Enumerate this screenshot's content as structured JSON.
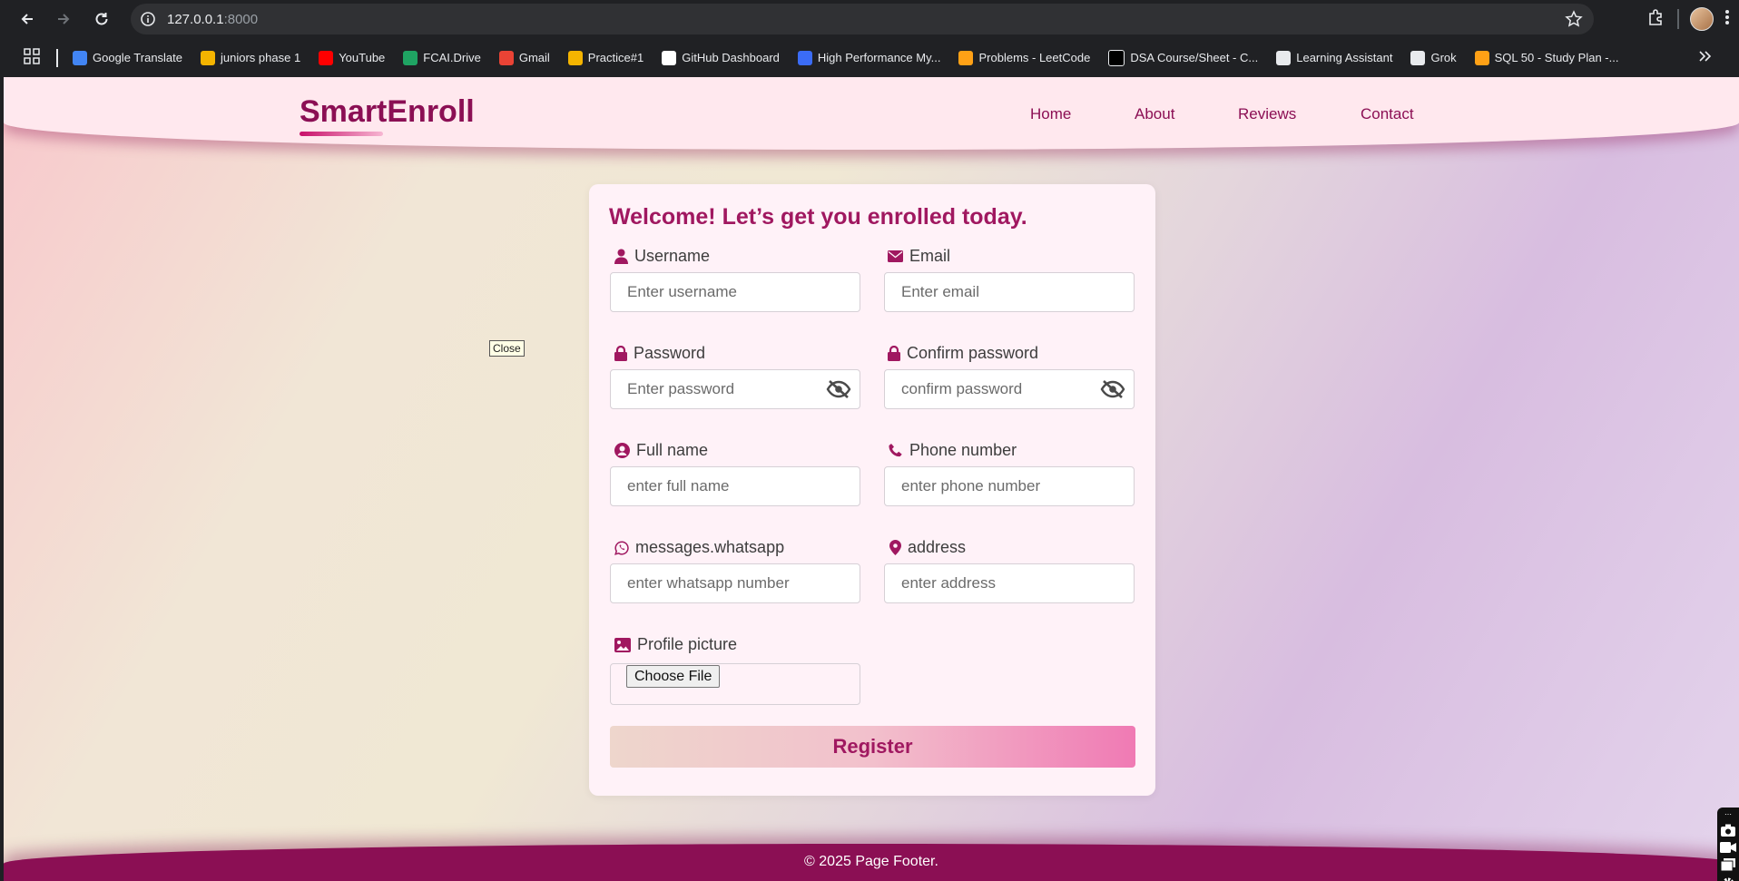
{
  "browser": {
    "url_host": "127.0.0.1",
    "url_port": ":8000",
    "bookmarks": [
      {
        "label": "Google Translate",
        "icon": "google-translate-icon",
        "color": "#4285f4"
      },
      {
        "label": "juniors phase 1",
        "icon": "bar-chart-icon",
        "color": "#f4b400"
      },
      {
        "label": "YouTube",
        "icon": "youtube-icon",
        "color": "#ff0000"
      },
      {
        "label": "FCAI.Drive",
        "icon": "google-drive-icon",
        "color": "#1fa463"
      },
      {
        "label": "Gmail",
        "icon": "gmail-icon",
        "color": "#ea4335"
      },
      {
        "label": "Practice#1",
        "icon": "bar-chart-icon",
        "color": "#f4b400"
      },
      {
        "label": "GitHub Dashboard",
        "icon": "github-icon",
        "color": "#ffffff"
      },
      {
        "label": "High Performance My...",
        "icon": "diamond-icon",
        "color": "#3b6cf6"
      },
      {
        "label": "Problems - LeetCode",
        "icon": "leetcode-icon",
        "color": "#ffa116"
      },
      {
        "label": "DSA Course/Sheet - C...",
        "icon": "tuf-icon",
        "color": "#000000"
      },
      {
        "label": "Learning Assistant",
        "icon": "image-icon",
        "color": "#e8eaed"
      },
      {
        "label": "Grok",
        "icon": "grok-icon",
        "color": "#e8eaed"
      },
      {
        "label": "SQL 50 - Study Plan -...",
        "icon": "leetcode-icon",
        "color": "#ffa116"
      }
    ]
  },
  "header": {
    "brand": "SmartEnroll",
    "nav": [
      "Home",
      "About",
      "Reviews",
      "Contact"
    ]
  },
  "tooltip": "Close",
  "form": {
    "title": "Welcome! Let’s get you enrolled today.",
    "username": {
      "label": "Username",
      "placeholder": "Enter username"
    },
    "email": {
      "label": "Email",
      "placeholder": "Enter email"
    },
    "password": {
      "label": "Password",
      "placeholder": "Enter password"
    },
    "confirm_password": {
      "label": "Confirm password",
      "placeholder": "confirm password"
    },
    "full_name": {
      "label": "Full name",
      "placeholder": "enter full name"
    },
    "phone": {
      "label": "Phone number",
      "placeholder": "enter phone number"
    },
    "whatsapp": {
      "label": "messages.whatsapp",
      "placeholder": "enter whatsapp number"
    },
    "address": {
      "label": "address",
      "placeholder": "enter address"
    },
    "profile_picture": {
      "label": "Profile picture",
      "button": "Choose File"
    },
    "submit": "Register"
  },
  "footer": {
    "text": "© 2025 Page Footer."
  },
  "colors": {
    "brand": "#8b0f54",
    "accent": "#a01860",
    "icon": "#a01860"
  }
}
